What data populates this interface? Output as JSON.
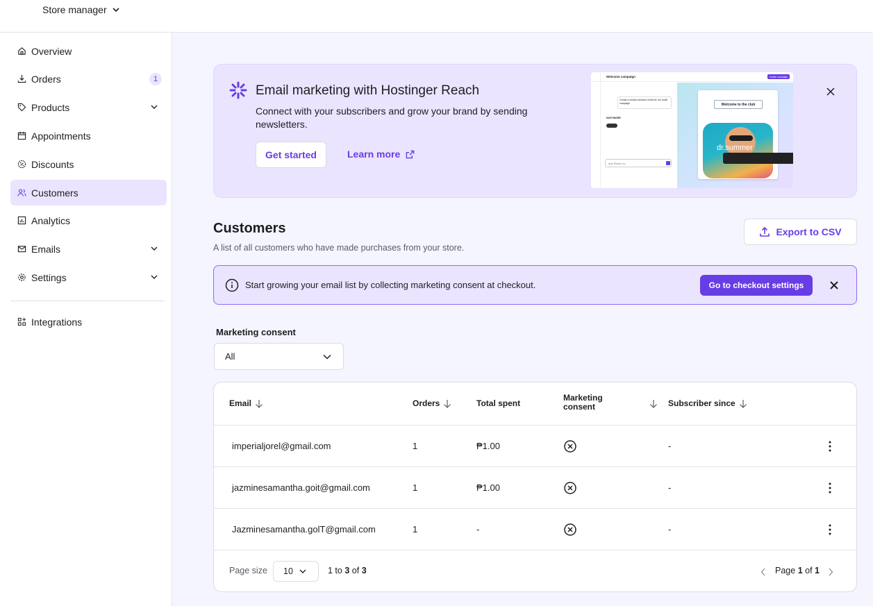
{
  "topbar": {
    "store_label": "Store manager"
  },
  "sidebar": {
    "items": [
      {
        "label": "Overview",
        "icon": "home-icon"
      },
      {
        "label": "Orders",
        "icon": "download-icon",
        "badge": "1"
      },
      {
        "label": "Products",
        "icon": "tag-icon"
      },
      {
        "label": "Appointments",
        "icon": "calendar-icon"
      },
      {
        "label": "Discounts",
        "icon": "discount-icon"
      },
      {
        "label": "Customers",
        "icon": "users-icon"
      },
      {
        "label": "Analytics",
        "icon": "chart-icon"
      },
      {
        "label": "Emails",
        "icon": "mail-icon"
      },
      {
        "label": "Settings",
        "icon": "gear-icon"
      },
      {
        "label": "Integrations",
        "icon": "grid-plus-icon"
      }
    ]
  },
  "banner": {
    "title": "Email marketing with Hostinger Reach",
    "description": "Connect with your subscribers and grow your brand by sending newsletters.",
    "primary_button": "Get started",
    "secondary_link": "Learn more",
    "preview": {
      "campaign_label": "Welcome campaign",
      "create_button": "Create campaign",
      "prompt": "Create a simple welcome email for our email campaign",
      "brand": "HOSTINGER",
      "input_placeholder": "Ask Reach to...",
      "email_heading": "Welcome to the club",
      "brand_overlay": "dr.summer"
    }
  },
  "page": {
    "title": "Customers",
    "subtitle": "A list of all customers who have made purchases from your store.",
    "export_button": "Export to CSV"
  },
  "alert": {
    "text": "Start growing your email list by collecting marketing consent at checkout.",
    "button": "Go to checkout settings"
  },
  "filter": {
    "label": "Marketing consent",
    "selected": "All"
  },
  "table": {
    "headers": {
      "email": "Email",
      "orders": "Orders",
      "total": "Total spent",
      "consent_line1": "Marketing",
      "consent_line2": "consent",
      "subscriber": "Subscriber since"
    },
    "rows": [
      {
        "email": "imperialjorel@gmail.com",
        "orders": "1",
        "total": "₱1.00",
        "subscriber": "-"
      },
      {
        "email": "jazminesamantha.goit@gmail.com",
        "orders": "1",
        "total": "₱1.00",
        "subscriber": "-"
      },
      {
        "email": "Jazminesamantha.golT@gmail.com",
        "orders": "1",
        "total": "-",
        "subscriber": "-"
      }
    ],
    "footer": {
      "page_size_label": "Page size",
      "page_size_value": "10",
      "range_prefix": "1 to",
      "range_end": "3",
      "range_of": "of",
      "range_total": "3",
      "page_prefix": "Page",
      "page_current": "1",
      "page_of": "of",
      "page_total": "1"
    }
  },
  "colors": {
    "accent": "#673de6",
    "accent_light": "#ebe4ff",
    "background": "#f4f5ff"
  }
}
